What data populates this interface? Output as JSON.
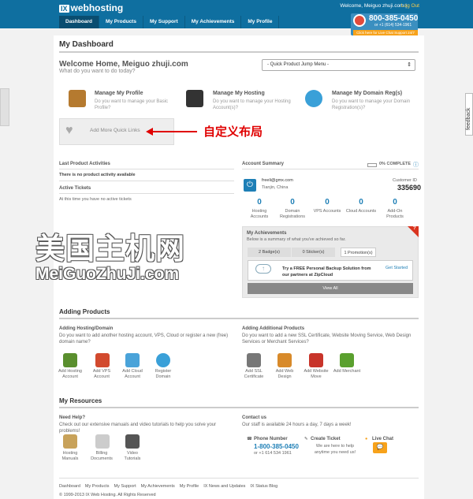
{
  "header": {
    "logo_ix": "IX",
    "logo_text": "webhosting",
    "welcome": "Welcome, Meiguo zhuji.com",
    "separator": "|",
    "logout": "Log Out",
    "nav": [
      "Dashboard",
      "My Products",
      "My Support",
      "My Achievements",
      "My Profile"
    ],
    "support_phone": "800-385-0450",
    "support_alt": "or +1 (614) 534-1961",
    "support_link": "Click here for Live Chat Support 24/7"
  },
  "page_title": "My Dashboard",
  "welcome": {
    "title": "Welcome Home, Meiguo zhuji.com",
    "subtitle": "What do you want to do today?",
    "jump_menu": "- Quick Product Jump Menu -"
  },
  "quick_links": [
    {
      "title": "Manage My Profile",
      "desc": "Do you want to manage your Basic Profile?",
      "icon": "address-book-icon"
    },
    {
      "title": "Manage My Hosting",
      "desc": "Do you want to manage your Hosting Account(s)?",
      "icon": "linux-windows-icon"
    },
    {
      "title": "Manage My Domain Reg(s)",
      "desc": "Do you want to manage your Domain Registration(s)?",
      "icon": "www-globe-icon"
    }
  ],
  "add_quick_links": "Add More Quick Links",
  "annotation": "自定义布局",
  "last_activity": {
    "title": "Last Product Activities",
    "text": "There is no product activity available"
  },
  "active_tickets": {
    "title": "Active Tickets",
    "text": "At this time you have no active tickets"
  },
  "account_summary": {
    "title": "Account Summary",
    "complete": "0% COMPLETE",
    "email": "freeli@gmx.com",
    "location": "Tianjin, China",
    "customer_id_label": "Customer ID",
    "customer_id": "335690",
    "stats": [
      {
        "value": "0",
        "label": "Hosting Accounts"
      },
      {
        "value": "0",
        "label": "Domain Registrations"
      },
      {
        "value": "0",
        "label": "VPS Accounts"
      },
      {
        "value": "0",
        "label": "Cloud Accounts"
      },
      {
        "value": "0",
        "label": "Add-On Products"
      }
    ]
  },
  "achievements": {
    "title": "My Achievements",
    "subtitle": "Below is a summary of what you've achieved so far.",
    "tabs": [
      "2 Badge(s)",
      "0 Sticker(s)",
      "1 Promotion(s)"
    ],
    "promo_text": "Try a FREE Personal Backup Solution from our partners at ZipCloud",
    "get_started": "Get Started",
    "view_all": "View All"
  },
  "watermark": {
    "line1": "美国主机网",
    "line2": "MeiGuoZhuJi.com"
  },
  "adding_products": {
    "title": "Adding Products",
    "left_title": "Adding Hosting/Domain",
    "left_desc": "Do you want to add another hosting account, VPS, Cloud or register a new (free) domain name?",
    "left_items": [
      "Add Hosting Account",
      "Add VPS Account",
      "Add Cloud Account",
      "Register Domain"
    ],
    "right_title": "Adding Additional Products",
    "right_desc": "Do you want to add a new SSL Certificate, Website Moving Service, Web Design Services or Merchant Services?",
    "right_items": [
      "Add SSL Certificate",
      "Add Web Design",
      "Add Website Move",
      "Add Merchant"
    ]
  },
  "resources": {
    "title": "My Resources",
    "help_title": "Need Help?",
    "help_desc": "Check out our extensive manuals and video tutorials to help you solve your problems!",
    "items": [
      "Hosting Manuals",
      "Billing Documents",
      "Video Tutorials"
    ],
    "contact_title": "Contact us",
    "contact_desc": "Our staff is available 24 hours a day, 7 days a week!",
    "phone_label": "Phone Number",
    "phone": "1-800-385-0450",
    "phone_alt": "or +1 614 534 1961",
    "ticket_label": "Create Ticket",
    "ticket_desc": "We are here to help anytime you need us!",
    "chat_label": "Live Chat"
  },
  "footer": {
    "links": [
      "Dashboard",
      "My Products",
      "My Support",
      "My Achievements",
      "My Profile",
      "IX News and Updates",
      "IX Status Blog"
    ],
    "copyright": "© 1999-2013 IX Web Hosting. All Rights Reserved"
  },
  "feedback": "feedback",
  "colors": {
    "brand": "#0f6fa0",
    "accent": "#f7a21b",
    "annotation": "#e00000"
  }
}
